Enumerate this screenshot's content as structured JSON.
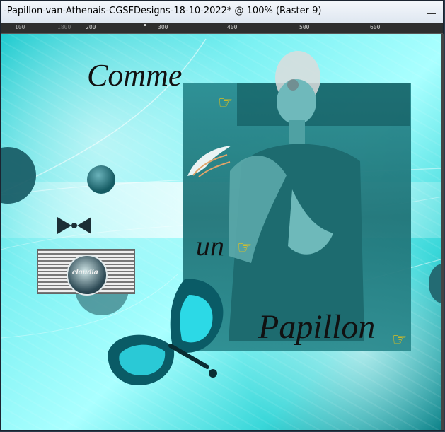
{
  "window": {
    "title": "-Papillon-van-Athenais-CGSFDesigns-18-10-2022* @ 100% (Raster 9)"
  },
  "ruler": {
    "labels": [
      "100",
      "200",
      "300",
      "400",
      "500",
      "600"
    ],
    "faded_label": "1800"
  },
  "artwork": {
    "text_words": [
      "Comme",
      "un",
      "Papillon"
    ],
    "watermark": "claudia",
    "icons": [
      "pointing-hand",
      "pointing-hand",
      "pointing-hand"
    ],
    "colors": {
      "primary_teal": "#12c7cc",
      "dark_teal": "#1a5f68",
      "water_bright": "#4ef4f4",
      "hand_yellow": "#f1c40f"
    }
  }
}
